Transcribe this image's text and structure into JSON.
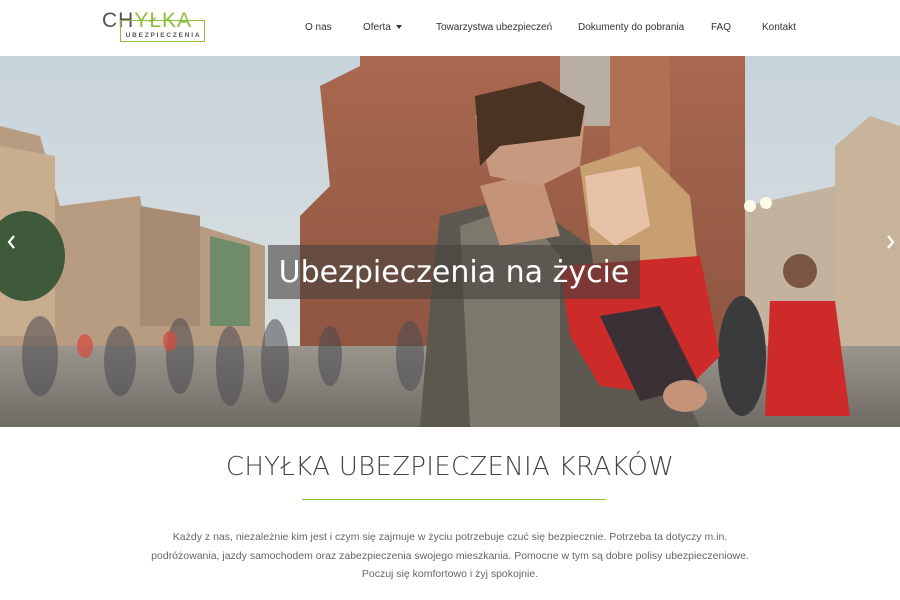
{
  "logo": {
    "main_prefix": "CH",
    "main_accent": "YŁKA",
    "sub": "UBEZPIECZENIA"
  },
  "nav": {
    "items": [
      {
        "label": "O nas"
      },
      {
        "label": "Oferta",
        "has_dropdown": true
      },
      {
        "label": "Towarzystwa ubezpieczeń"
      },
      {
        "label": "Dokumenty do pobrania"
      },
      {
        "label": "FAQ"
      },
      {
        "label": "Kontakt"
      }
    ]
  },
  "hero": {
    "caption": "Ubezpieczenia na życie",
    "prev_icon": "chevron-left-icon",
    "next_icon": "chevron-right-icon"
  },
  "content": {
    "heading": "CHYŁKA UBEZPIECZENIA KRAKÓW",
    "intro": "Każdy z nas, niezależnie kim jest i czym się zajmuje w życiu potrzebuje czuć się bezpiecznie. Potrzeba ta dotyczy m.in. podróżowania, jazdy samochodem oraz zabezpieczenia swojego mieszkania. Pomocne w tym są dobre polisy ubezpieczeniowe. Poczuj się komfortowo i żyj spokojnie."
  },
  "colors": {
    "accent": "#8dbf3a",
    "text": "#333333",
    "caption_bg": "rgba(70,65,62,0.6)"
  }
}
